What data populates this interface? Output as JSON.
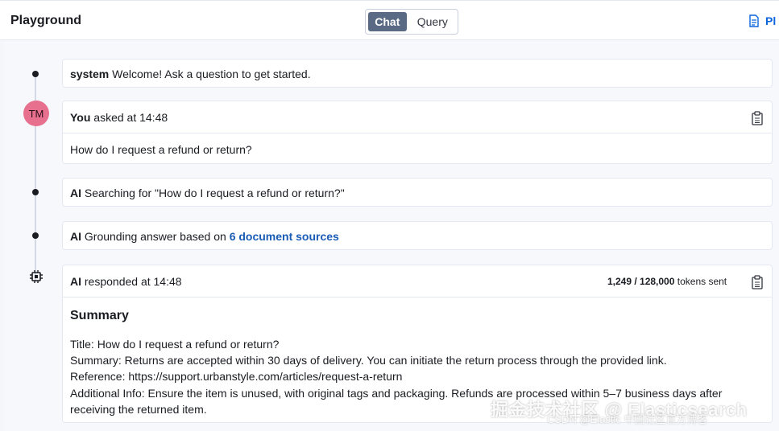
{
  "header": {
    "title": "Playground",
    "tabs": [
      {
        "label": "Chat",
        "selected": true
      },
      {
        "label": "Query",
        "selected": false
      }
    ],
    "right_label": "Pl"
  },
  "messages": {
    "system": {
      "sender": "system",
      "text": "Welcome! Ask a question to get started."
    },
    "user": {
      "avatar_initials": "TM",
      "sender": "You",
      "meta": "asked at 14:48",
      "text": "How do I request a refund or return?"
    },
    "search": {
      "sender": "AI",
      "text": "Searching for \"How do I request a refund or return?\""
    },
    "grounding": {
      "sender": "AI",
      "text": "Grounding answer based on ",
      "link": "6 document sources"
    },
    "response": {
      "sender": "AI",
      "meta": "responded at 14:48",
      "tokens_count": "1,249 / 128,000",
      "tokens_suffix": "tokens sent",
      "summary_title": "Summary",
      "lines": [
        "Title: How do I request a refund or return?",
        "Summary: Returns are accepted within 30 days of delivery. You can initiate the return process through the provided link.",
        "Reference: https://support.urbanstyle.com/articles/request-a-return",
        "Additional Info: Ensure the item is unused, with original tags and packaging. Refunds are processed within 5–7 business days after",
        "receiving the returned item."
      ]
    }
  },
  "watermark": {
    "line1": "掘金技术社区 @ Elasticsearch",
    "line2": "CSDN @Elastic 中国社区官方博客"
  },
  "colors": {
    "accent": "#0b64dd",
    "segment_selected": "#5a6a85",
    "avatar": "#e7708f",
    "link": "#1a5bb5"
  }
}
